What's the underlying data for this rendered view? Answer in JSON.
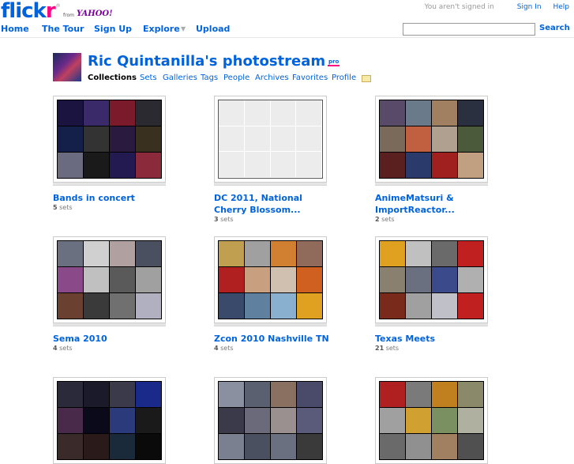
{
  "logo": {
    "word_a": "flick",
    "word_b": "r",
    "reg": "®",
    "from": "from",
    "yahoo": "YAHOO!"
  },
  "userbar": {
    "status": "You aren't signed in",
    "sign_in": "Sign In",
    "help": "Help"
  },
  "nav": [
    {
      "label": "Home"
    },
    {
      "label": "The Tour"
    },
    {
      "label": "Sign Up"
    },
    {
      "label": "Explore",
      "caret": "▼"
    },
    {
      "label": "Upload"
    }
  ],
  "search": {
    "value": "",
    "button": "Search"
  },
  "profile": {
    "title": "Ric Quintanilla's photostream",
    "pro_badge": "pro",
    "subnav": [
      "Collections",
      "Sets",
      "Galleries",
      "Tags",
      "People",
      "Archives",
      "Favorites",
      "Profile"
    ],
    "mail_icon": "envelope-icon"
  },
  "collections": [
    {
      "title_lines": [
        "Bands in concert"
      ],
      "count": "5",
      "unit": "sets",
      "palette": [
        "#1c1440",
        "#3a2a6a",
        "#7a1a2a",
        "#2a2a30",
        "#15204a",
        "#333",
        "#2a1a40",
        "#3a3020",
        "#6a6a80",
        "#1a1a1a",
        "#221a50",
        "#8a2a3a"
      ]
    },
    {
      "title_lines": [
        "DC 2011, National",
        "Cherry Blossom..."
      ],
      "count": "3",
      "unit": "sets",
      "palette": []
    },
    {
      "title_lines": [
        "AnimeMatsuri &",
        "ImportReactor..."
      ],
      "count": "2",
      "unit": "sets",
      "palette": [
        "#5a4a6a",
        "#6a7a8a",
        "#a08060",
        "#2a3040",
        "#7a6a5a",
        "#c06040",
        "#b0a090",
        "#4a5a3a",
        "#5a2020",
        "#2a3a6a",
        "#a02020",
        "#c0a080"
      ]
    },
    {
      "title_lines": [
        "Sema 2010"
      ],
      "count": "4",
      "unit": "sets",
      "palette": [
        "#6a7080",
        "#d0d0d0",
        "#b0a0a0",
        "#4a5060",
        "#8a4a8a",
        "#c0c0c0",
        "#5a5a5a",
        "#a0a0a0",
        "#6a4030",
        "#3a3a3a",
        "#707070",
        "#b0b0c0"
      ]
    },
    {
      "title_lines": [
        "Zcon 2010 Nashville TN"
      ],
      "count": "4",
      "unit": "sets",
      "palette": [
        "#c0a050",
        "#a0a0a0",
        "#d08030",
        "#906a5a",
        "#b02020",
        "#c8a080",
        "#d0c0b0",
        "#d06020",
        "#3a4a6a",
        "#6080a0",
        "#8ab0d0",
        "#e0a020"
      ]
    },
    {
      "title_lines": [
        "Texas Meets"
      ],
      "count": "21",
      "unit": "sets",
      "palette": [
        "#e0a020",
        "#c0c0c0",
        "#6a6a6a",
        "#c02020",
        "#8a8070",
        "#6a7080",
        "#3a4a8a",
        "#b0b0b0",
        "#7a2a1a",
        "#a0a0a0",
        "#c0c0c8",
        "#c02020"
      ]
    },
    {
      "title_lines": [
        ""
      ],
      "count": "",
      "unit": "",
      "palette": [
        "#2a2a3a",
        "#1a1a2a",
        "#3a3a4a",
        "#1a2a8a",
        "#4a2a4a",
        "#0a0a1a",
        "#2a3a7a",
        "#1a1a1a",
        "#3a2a2a",
        "#2a1a1a",
        "#1a2a3a",
        "#0a0a0a"
      ]
    },
    {
      "title_lines": [
        ""
      ],
      "count": "",
      "unit": "",
      "palette": [
        "#8a90a0",
        "#5a6070",
        "#8a7060",
        "#4a4a6a",
        "#3a3a4a",
        "#6a6a7a",
        "#9a9090",
        "#5a5a7a",
        "#7a8090",
        "#4a5060",
        "#6a7080",
        "#3a3a3a"
      ]
    },
    {
      "title_lines": [
        ""
      ],
      "count": "",
      "unit": "",
      "palette": [
        "#b02020",
        "#7a7a7a",
        "#c08020",
        "#8a8a6a",
        "#a0a0a0",
        "#d0a030",
        "#7a9060",
        "#b0b0a0",
        "#6a6a6a",
        "#909090",
        "#a08060",
        "#505050"
      ]
    }
  ]
}
